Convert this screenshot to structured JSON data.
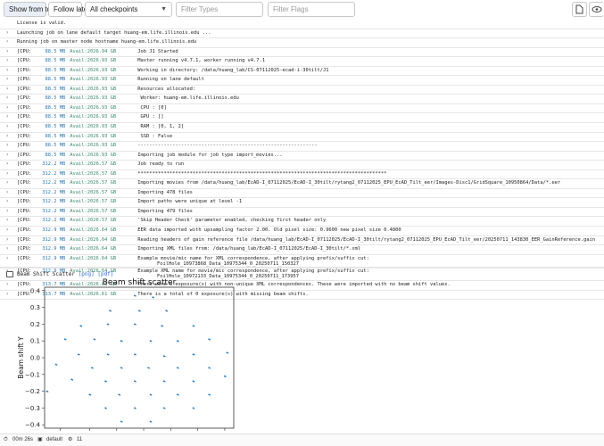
{
  "toolbar": {
    "show_from_top": "Show from top",
    "follow_latest": "Follow latest",
    "checkpoints": "All checkpoints",
    "filter_types_placeholder": "Filter Types",
    "filter_flags_placeholder": "Filter Flags"
  },
  "log": [
    {
      "chev": "",
      "text": "License is valid."
    },
    {
      "chev": "›",
      "text": "Launching job on lane default target huang-em.life.illinois.edu ..."
    },
    {
      "chev": "›",
      "text": "Running job on master node hostname huang-em.life.illinois.edu"
    },
    {
      "chev": "›",
      "cpu": "88.5 MB",
      "avail": "Avail:2026.94 GB",
      "msg": "Job J1 Started"
    },
    {
      "chev": "›",
      "cpu": "88.5 MB",
      "avail": "Avail:2026.93 GB",
      "msg": "Master running v4.7.1, worker running v4.7.1"
    },
    {
      "chev": "›",
      "cpu": "88.5 MB",
      "avail": "Avail:2026.93 GB",
      "msg": "Working in directory: /data/huang_lab/CS-07112025-ecad-i-30tilt/J1"
    },
    {
      "chev": "›",
      "cpu": "88.5 MB",
      "avail": "Avail:2026.93 GB",
      "msg": "Running on lane default"
    },
    {
      "chev": "›",
      "cpu": "88.5 MB",
      "avail": "Avail:2026.93 GB",
      "msg": "Resources allocated:"
    },
    {
      "chev": "›",
      "cpu": "88.5 MB",
      "avail": "Avail:2026.93 GB",
      "msg": "  Worker:  huang-em.life.illinois.edu"
    },
    {
      "chev": "›",
      "cpu": "88.5 MB",
      "avail": "Avail:2026.93 GB",
      "msg": "  CPU   :  [0]"
    },
    {
      "chev": "›",
      "cpu": "88.5 MB",
      "avail": "Avail:2026.93 GB",
      "msg": "  GPU   :  []"
    },
    {
      "chev": "›",
      "cpu": "88.5 MB",
      "avail": "Avail:2026.93 GB",
      "msg": "  RAM   :  [0, 1, 2]"
    },
    {
      "chev": "›",
      "cpu": "88.5 MB",
      "avail": "Avail:2026.93 GB",
      "msg": "  SSD   :  False"
    },
    {
      "chev": "›",
      "cpu": "88.5 MB",
      "avail": "Avail:2026.93 GB",
      "msg": "--------------------------------------------------------------"
    },
    {
      "chev": "›",
      "cpu": "88.5 MB",
      "avail": "Avail:2026.93 GB",
      "msg": "Importing job module for job type import_movies..."
    },
    {
      "chev": "›",
      "cpu": "312.2 MB",
      "avail": "Avail:2026.57 GB",
      "msg": "Job ready to run"
    },
    {
      "chev": "›",
      "cpu": "312.2 MB",
      "avail": "Avail:2026.57 GB",
      "msg": "**************************************************************************************"
    },
    {
      "chev": "›",
      "cpu": "312.2 MB",
      "avail": "Avail:2026.57 GB",
      "msg": "Importing movies from /data/huang_lab/EcAD-I_07112025/EcAD-I_30tilt/rytang2_07112025_EPU_EcAD_Tilt_eer/Images-Disc1/GridSquare_10950864/Data/*.eer"
    },
    {
      "chev": "›",
      "cpu": "312.2 MB",
      "avail": "Avail:2026.57 GB",
      "msg": "Importing 478 files"
    },
    {
      "chev": "›",
      "cpu": "312.2 MB",
      "avail": "Avail:2026.57 GB",
      "msg": "Import paths were unique at level -1"
    },
    {
      "chev": "›",
      "cpu": "312.2 MB",
      "avail": "Avail:2026.57 GB",
      "msg": "Importing 479 files"
    },
    {
      "chev": "›",
      "cpu": "312.2 MB",
      "avail": "Avail:2026.57 GB",
      "msg": "'Skip Header Check' parameter enabled, checking first header only"
    },
    {
      "chev": "›",
      "cpu": "312.9 MB",
      "avail": "Avail:2026.64 GB",
      "msg": "EER data imported with upsampling factor 2.00. Old pixel size: 0.9600 new pixel size 0.4800"
    },
    {
      "chev": "›",
      "cpu": "312.9 MB",
      "avail": "Avail:2026.64 GB",
      "msg": "Reading headers of gain reference file /data/huang_lab/EcAD-I_07112025/EcAD-I_30tilt/rytang2_07112025_EPU_EcAD_Tilt_eer/20250711_143830_EER_GainReference.gain"
    },
    {
      "chev": "›",
      "cpu": "312.9 MB",
      "avail": "Avail:2026.64 GB",
      "msg": "Importing XML files from: /data/huang_lab/EcAD-I_07112025/EcAD-I_30tilt/*.xml"
    },
    {
      "chev": "›",
      "cpu": "312.9 MB",
      "avail": "Avail:2026.64 GB",
      "msg": "Example movie/mic name for XML correspondence, after applying prefix/suffix cut:",
      "cont": "FoilHole_10973868_Data_10975344_0_20250711_150327",
      "tall": true
    },
    {
      "chev": "›",
      "cpu": "312.9 MB",
      "avail": "Avail:2026.64 GB",
      "msg": "Example XML name for movie/mic correspondence, after applying prefix/suffix cut:",
      "cont": "FoilHole_10972133_Data_10975344_0_20250711_173957",
      "tall": true
    },
    {
      "chev": "›",
      "cpu": "313.7 MB",
      "avail": "Avail:2026.61 GB",
      "msg": "There were 0 exposure(s) with non-unique XML correspondences. These were imported with no beam shift values."
    },
    {
      "chev": "›",
      "cpu": "313.7 MB",
      "avail": "Avail:2026.61 GB",
      "msg": "There is a total of 0 exposure(s) with missing beam shifts."
    }
  ],
  "cpu_label": "[CPU:",
  "plot_header": {
    "title": "Beam Shift Scatter",
    "png": "[png]",
    "pdf": "[pdf]"
  },
  "chart_data": {
    "type": "scatter",
    "title": "Beam shift scatter",
    "xlabel": "",
    "ylabel": "Beam shift Y",
    "ylim": [
      -0.42,
      0.42
    ],
    "xlim": [
      -0.42,
      0.42
    ],
    "yticks": [
      "0.4",
      "0.3",
      "0.2",
      "0.1",
      "0.0",
      "−0.1",
      "−0.2",
      "−0.3",
      "−0.4"
    ],
    "color": "#1f77b4",
    "points": [
      [
        -0.02,
        0.37
      ],
      [
        0.06,
        0.36
      ],
      [
        -0.13,
        0.28
      ],
      [
        0.0,
        0.28
      ],
      [
        0.12,
        0.28
      ],
      [
        -0.26,
        0.19
      ],
      [
        -0.14,
        0.2
      ],
      [
        -0.02,
        0.2
      ],
      [
        0.1,
        0.19
      ],
      [
        0.24,
        0.19
      ],
      [
        -0.33,
        0.11
      ],
      [
        -0.2,
        0.11
      ],
      [
        -0.08,
        0.1
      ],
      [
        0.05,
        0.1
      ],
      [
        0.17,
        0.1
      ],
      [
        0.31,
        0.11
      ],
      [
        -0.27,
        0.02
      ],
      [
        -0.14,
        0.02
      ],
      [
        -0.02,
        0.02
      ],
      [
        0.11,
        0.01
      ],
      [
        0.24,
        0.02
      ],
      [
        0.39,
        0.03
      ],
      [
        -0.37,
        -0.04
      ],
      [
        -0.21,
        -0.06
      ],
      [
        -0.08,
        -0.06
      ],
      [
        0.04,
        -0.06
      ],
      [
        0.17,
        -0.06
      ],
      [
        0.31,
        -0.06
      ],
      [
        -0.3,
        -0.13
      ],
      [
        -0.15,
        -0.14
      ],
      [
        -0.02,
        -0.14
      ],
      [
        0.11,
        -0.14
      ],
      [
        0.24,
        -0.14
      ],
      [
        0.38,
        -0.11
      ],
      [
        -0.41,
        -0.2
      ],
      [
        -0.22,
        -0.22
      ],
      [
        -0.09,
        -0.22
      ],
      [
        0.05,
        -0.22
      ],
      [
        0.17,
        -0.22
      ],
      [
        0.31,
        -0.22
      ],
      [
        -0.15,
        -0.3
      ],
      [
        -0.02,
        -0.3
      ],
      [
        0.11,
        -0.3
      ],
      [
        0.24,
        -0.3
      ],
      [
        -0.08,
        -0.38
      ],
      [
        0.05,
        -0.38
      ]
    ]
  },
  "status": {
    "time": "00m 26s",
    "lane": "default",
    "count": "11"
  }
}
